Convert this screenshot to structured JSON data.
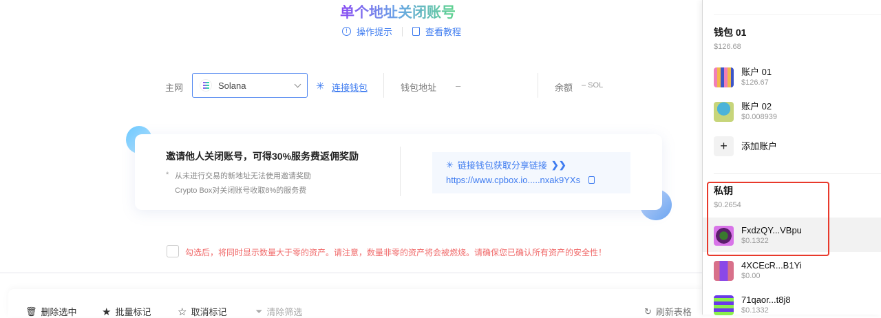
{
  "header": {
    "title": "单个地址关闭账号",
    "tips": "操作提示",
    "tutorial": "查看教程"
  },
  "network": {
    "label": "主网",
    "selected": "Solana",
    "connect": "连接钱包",
    "address_label": "钱包地址",
    "address_value": "–",
    "balance_label": "余额",
    "balance_value": "– SOL"
  },
  "invite": {
    "title": "邀请他人关闭账号，可得30%服务费返佣奖励",
    "note_star": "*",
    "note1": "从未进行交易的新地址无法使用邀请奖励",
    "note2": "Crypto Box对关闭账号收取8%的服务费",
    "share_link_label": "链接钱包获取分享链接",
    "share_url": "https://www.cpbox.io.....nxak9YXs"
  },
  "warning": "勾选后，将同时显示数量大于零的资产。请注意，数量非零的资产将会被燃烧。请确保您已确认所有资产的安全性！",
  "toolbar": {
    "delete": "删除选中",
    "mark": "批量标记",
    "unmark": "取消标记",
    "clear_filter": "清除筛选",
    "refresh": "刷新表格"
  },
  "panel": {
    "wallet": {
      "name": "钱包 01",
      "total": "$126.68",
      "accounts": [
        {
          "name": "账户 01",
          "value": "$126.67"
        },
        {
          "name": "账户 02",
          "value": "$0.008939"
        }
      ],
      "add": "添加账户"
    },
    "private": {
      "name": "私钥",
      "total": "$0.2654",
      "accounts": [
        {
          "name": "FxdzQY...VBpu",
          "value": "$0.1322"
        },
        {
          "name": "4XCEcR...B1Yi",
          "value": "$0.00"
        },
        {
          "name": "71qaor...t8j8",
          "value": "$0.1332"
        }
      ]
    }
  },
  "colors": {
    "accent": "#3f7cf0",
    "warning": "#f06a6a",
    "highlight": "#e8392b"
  }
}
